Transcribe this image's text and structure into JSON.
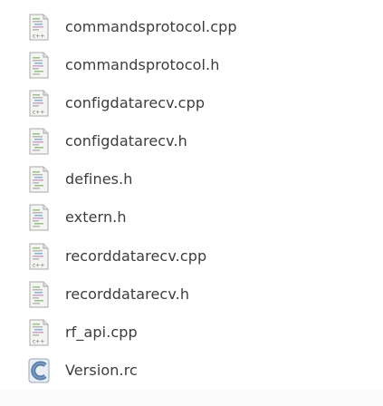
{
  "files": [
    {
      "name": "commandsprotocol.cpp",
      "icon": "cpp-source-file-icon"
    },
    {
      "name": "commandsprotocol.h",
      "icon": "header-file-icon"
    },
    {
      "name": "configdatarecv.cpp",
      "icon": "cpp-source-file-icon"
    },
    {
      "name": "configdatarecv.h",
      "icon": "header-file-icon"
    },
    {
      "name": "defines.h",
      "icon": "header-file-icon"
    },
    {
      "name": "extern.h",
      "icon": "header-file-icon"
    },
    {
      "name": "recorddatarecv.cpp",
      "icon": "cpp-source-file-icon"
    },
    {
      "name": "recorddatarecv.h",
      "icon": "header-file-icon"
    },
    {
      "name": "rf_api.cpp",
      "icon": "cpp-source-file-icon"
    },
    {
      "name": "Version.rc",
      "icon": "resource-file-icon"
    }
  ],
  "colors": {
    "text": "#3c3c3c",
    "icon_paper": "#f4f4f2",
    "icon_border": "#a9aaa6",
    "resource_icon_blue": "#5b7da8"
  }
}
